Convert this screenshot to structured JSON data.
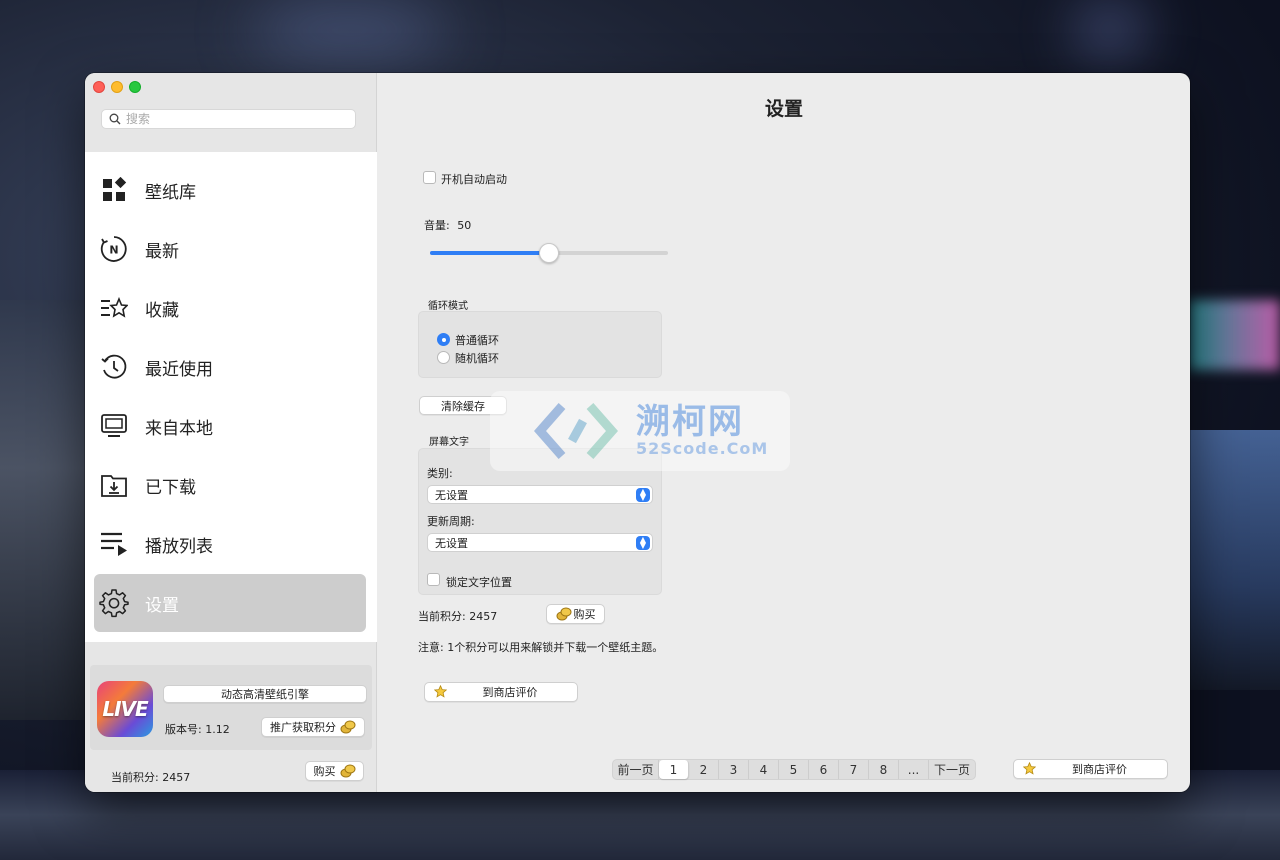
{
  "window": {
    "title": "设置"
  },
  "sidebar": {
    "search_placeholder": "搜索",
    "items": [
      {
        "label": "壁纸库",
        "icon": "grid-diamond-icon"
      },
      {
        "label": "最新",
        "icon": "new-badge-icon"
      },
      {
        "label": "收藏",
        "icon": "list-star-icon"
      },
      {
        "label": "最近使用",
        "icon": "history-clock-icon"
      },
      {
        "label": "来自本地",
        "icon": "monitor-icon"
      },
      {
        "label": "已下载",
        "icon": "download-folder-icon"
      },
      {
        "label": "播放列表",
        "icon": "playlist-icon"
      },
      {
        "label": "设置",
        "icon": "gear-icon",
        "active": true
      }
    ],
    "promo": {
      "logo_text": "LIVE",
      "title_button": "动态高清壁纸引擎",
      "version_label": "版本号: 1.12",
      "earn_button": "推广获取积分"
    },
    "points_label": "当前积分: 2457",
    "buy_button": "购买"
  },
  "settings": {
    "autostart_label": "开机自动启动",
    "autostart_checked": false,
    "volume_label": "音量:",
    "volume_value": "50",
    "volume_fraction": 0.5,
    "loop_mode": {
      "title": "循环模式",
      "options": [
        "普通循环",
        "随机循环"
      ],
      "selected": "普通循环"
    },
    "clear_cache_button": "清除缓存",
    "screen_text": {
      "title": "屏幕文字",
      "category_label": "类别:",
      "category_value": "无设置",
      "period_label": "更新周期:",
      "period_value": "无设置",
      "lock_label": "锁定文字位置",
      "lock_checked": false
    },
    "points_label": "当前积分: 2457",
    "buy_button": "购买",
    "note": "注意: 1个积分可以用来解锁并下载一个壁纸主题。",
    "rate_button": "到商店评价"
  },
  "pager": {
    "prev": "前一页",
    "pages": [
      "1",
      "2",
      "3",
      "4",
      "5",
      "6",
      "7",
      "8",
      "..."
    ],
    "current": "1",
    "next": "下一页"
  },
  "footer_rate_button": "到商店评价",
  "watermark": {
    "title": "溯柯网",
    "subtitle": "52Scode.CoM"
  },
  "colors": {
    "accent": "#2f7ef5",
    "active_item": "#cdcdcd",
    "window_bg": "#ececec"
  }
}
